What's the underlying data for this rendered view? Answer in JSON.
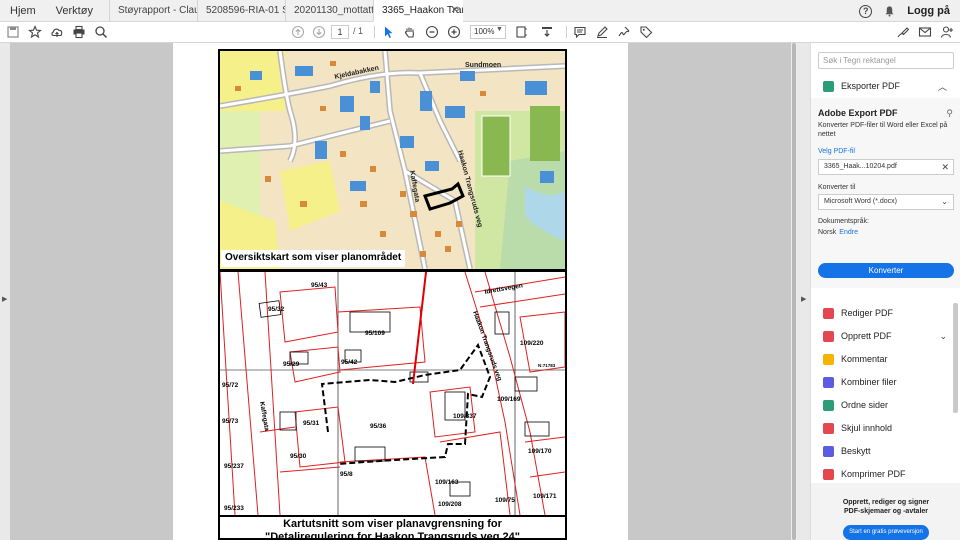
{
  "nav": {
    "home": "Hjem",
    "tools": "Verktøy"
  },
  "tabs": [
    {
      "label": "Støyrapport - Claus..."
    },
    {
      "label": "5208596-RIA-01 S..."
    },
    {
      "label": "20201130_mottatt..."
    },
    {
      "label": "3365_Haakon Trans..."
    }
  ],
  "header": {
    "help_icon": "?",
    "login": "Logg på"
  },
  "toolbar": {
    "page_current": "1",
    "page_total": "/ 1",
    "zoom": "100%"
  },
  "map": {
    "overview_caption": "Oversiktskart som viser planområdet",
    "caption_line1": "Kartutsnitt som viser planavgrensning for",
    "caption_line2": "\"Detaljregulering for Haakon Trangsruds veg 24\"",
    "streets_top": [
      "Kjeldabakken",
      "Sundmoen",
      "Haakon Trangsruds veg",
      "Kaffegata"
    ],
    "streets_bottom": [
      "Idrettsvegen",
      "Haakon Trangsruds veg",
      "Kaffegata"
    ],
    "plots": [
      "95/43",
      "95/32",
      "95/109",
      "109/220",
      "95/29",
      "95/42",
      "N:71783",
      "95/72",
      "109/169",
      "95/73",
      "95/31",
      "109/337",
      "95/36",
      "95/30",
      "109/170",
      "95/237",
      "95/8",
      "109/163",
      "109/208",
      "109/75",
      "109/171",
      "95/233"
    ]
  },
  "right_panel": {
    "search_placeholder": "Søk i Tegn rektangel",
    "export_header": "Eksporter PDF",
    "export_title": "Adobe Export PDF",
    "export_desc": "Konverter PDF-filer til Word eller Excel på nettet",
    "select_file": "Velg PDF-fil",
    "file_name": "3365_Haak...10204.pdf",
    "convert_to_label": "Konverter til",
    "convert_to_value": "Microsoft Word (*.docx)",
    "doc_lang_label": "Dokumentspråk:",
    "doc_lang_value": "Norsk",
    "doc_lang_edit": "Endre",
    "convert_button": "Konverter",
    "tools": [
      {
        "label": "Rediger PDF",
        "icon": "edit-pdf-icon",
        "color": "#e34850"
      },
      {
        "label": "Opprett PDF",
        "icon": "create-pdf-icon",
        "color": "#e34850"
      },
      {
        "label": "Kommentar",
        "icon": "comment-icon",
        "color": "#f4b400"
      },
      {
        "label": "Kombiner filer",
        "icon": "combine-icon",
        "color": "#5c5ce0"
      },
      {
        "label": "Ordne sider",
        "icon": "organize-icon",
        "color": "#2d9d78"
      },
      {
        "label": "Skjul innhold",
        "icon": "redact-icon",
        "color": "#e34850"
      },
      {
        "label": "Beskytt",
        "icon": "protect-icon",
        "color": "#5c5ce0"
      },
      {
        "label": "Komprimer PDF",
        "icon": "compress-icon",
        "color": "#e34850"
      }
    ],
    "promo_line1": "Opprett, rediger og signer",
    "promo_line2": "PDF-skjemaer og -avtaler",
    "trial_button": "Start en gratis prøveversjon"
  }
}
